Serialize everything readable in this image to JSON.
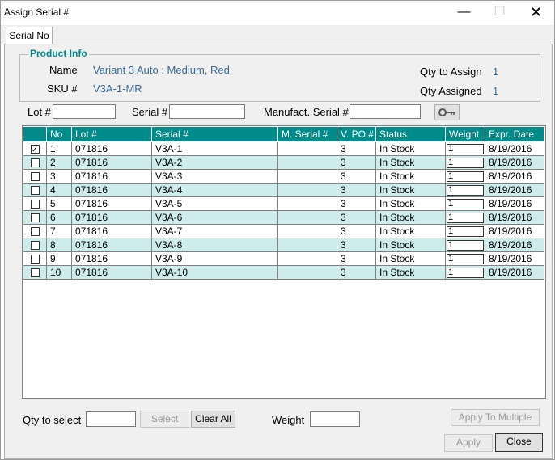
{
  "window": {
    "title": "Assign Serial #"
  },
  "tabs": [
    {
      "label": "Serial No"
    }
  ],
  "product_info": {
    "legend": "Product Info",
    "name_label": "Name",
    "name_value": "Variant 3 Auto : Medium, Red",
    "sku_label": "SKU #",
    "sku_value": "V3A-1-MR",
    "qty_to_assign_label": "Qty to Assign",
    "qty_to_assign_value": "1",
    "qty_assigned_label": "Qty Assigned",
    "qty_assigned_value": "1"
  },
  "filters": {
    "lot_label": "Lot #",
    "serial_label": "Serial #",
    "manufact_label": "Manufact. Serial #",
    "lot_value": "",
    "serial_value": "",
    "manufact_value": "",
    "search_icon": "key-icon"
  },
  "grid": {
    "columns": [
      "",
      "No",
      "Lot #",
      "Serial #",
      "M. Serial #",
      "V. PO #",
      "Status",
      "Weight",
      "Expr. Date"
    ],
    "header_color": "#008b8b",
    "alt_row_color": "#cdeceb",
    "rows": [
      {
        "checked": true,
        "no": "1",
        "lot": "071816",
        "serial": "V3A-1",
        "mserial": "",
        "vpo": "3",
        "status": "In Stock",
        "weight": "1",
        "expr": "8/19/2016"
      },
      {
        "checked": false,
        "no": "2",
        "lot": "071816",
        "serial": "V3A-2",
        "mserial": "",
        "vpo": "3",
        "status": "In Stock",
        "weight": "1",
        "expr": "8/19/2016"
      },
      {
        "checked": false,
        "no": "3",
        "lot": "071816",
        "serial": "V3A-3",
        "mserial": "",
        "vpo": "3",
        "status": "In Stock",
        "weight": "1",
        "expr": "8/19/2016"
      },
      {
        "checked": false,
        "no": "4",
        "lot": "071816",
        "serial": "V3A-4",
        "mserial": "",
        "vpo": "3",
        "status": "In Stock",
        "weight": "1",
        "expr": "8/19/2016"
      },
      {
        "checked": false,
        "no": "5",
        "lot": "071816",
        "serial": "V3A-5",
        "mserial": "",
        "vpo": "3",
        "status": "In Stock",
        "weight": "1",
        "expr": "8/19/2016"
      },
      {
        "checked": false,
        "no": "6",
        "lot": "071816",
        "serial": "V3A-6",
        "mserial": "",
        "vpo": "3",
        "status": "In Stock",
        "weight": "1",
        "expr": "8/19/2016"
      },
      {
        "checked": false,
        "no": "7",
        "lot": "071816",
        "serial": "V3A-7",
        "mserial": "",
        "vpo": "3",
        "status": "In Stock",
        "weight": "1",
        "expr": "8/19/2016"
      },
      {
        "checked": false,
        "no": "8",
        "lot": "071816",
        "serial": "V3A-8",
        "mserial": "",
        "vpo": "3",
        "status": "In Stock",
        "weight": "1",
        "expr": "8/19/2016"
      },
      {
        "checked": false,
        "no": "9",
        "lot": "071816",
        "serial": "V3A-9",
        "mserial": "",
        "vpo": "3",
        "status": "In Stock",
        "weight": "1",
        "expr": "8/19/2016"
      },
      {
        "checked": false,
        "no": "10",
        "lot": "071816",
        "serial": "V3A-10",
        "mserial": "",
        "vpo": "3",
        "status": "In Stock",
        "weight": "1",
        "expr": "8/19/2016"
      }
    ]
  },
  "footer": {
    "qty_to_select_label": "Qty to select",
    "qty_to_select_value": "",
    "select_label": "Select",
    "clear_all_label": "Clear All",
    "weight_label": "Weight",
    "weight_value": "",
    "apply_multiple_label": "Apply To Multiple",
    "apply_label": "Apply",
    "close_label": "Close"
  }
}
